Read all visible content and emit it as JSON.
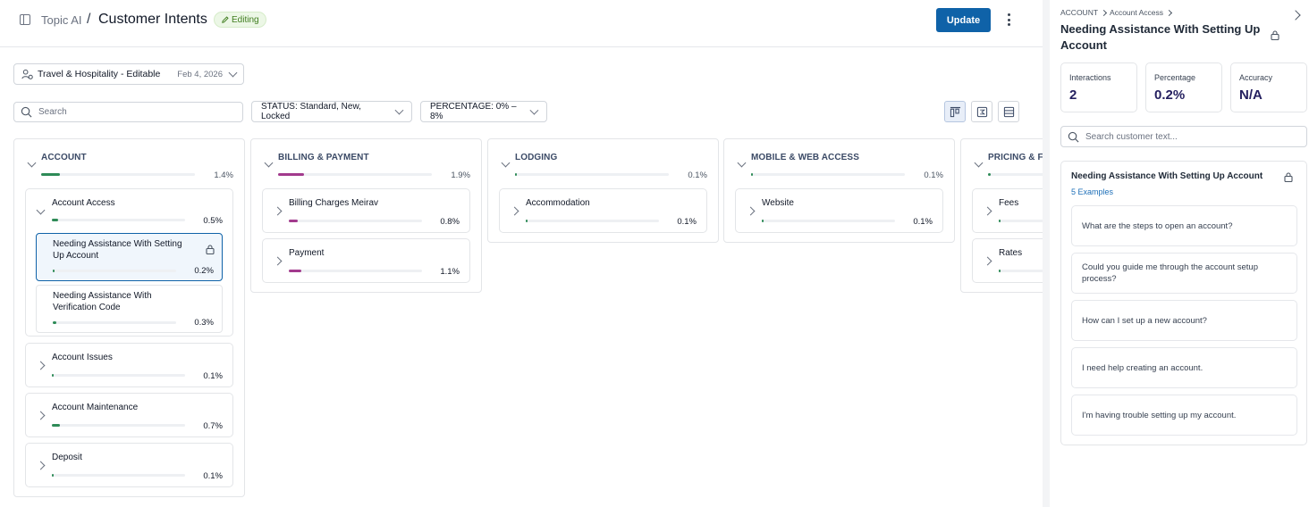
{
  "header": {
    "breadcrumb_root": "Topic AI",
    "separator": "/",
    "title": "Customer Intents",
    "badge": "Editing",
    "update_label": "Update"
  },
  "toolbar": {
    "model_name": "Travel & Hospitality - Editable",
    "model_date": "Feb 4, 2026",
    "search_placeholder": "Search",
    "status_filter": "STATUS:  Standard, New, Locked",
    "percentage_filter": "PERCENTAGE: 0% – 8%"
  },
  "colors": {
    "primary": "#0f62a8",
    "bar_green": "#2e8b57",
    "bar_purple": "#a23a8d",
    "stat_value": "#241f5f"
  },
  "columns": [
    {
      "title": "ACCOUNT",
      "pct_label": "1.4%",
      "pct": 1.4,
      "color": "#2e8b57",
      "cards": [
        {
          "title": "Account Access",
          "pct_label": "0.5%",
          "pct": 0.5,
          "expanded": true,
          "subs": [
            {
              "title": "Needing Assistance With Setting Up Account",
              "pct_label": "0.2%",
              "pct": 0.2,
              "locked": true,
              "selected": true
            },
            {
              "title": "Needing Assistance With Verification Code",
              "pct_label": "0.3%",
              "pct": 0.3,
              "locked": false,
              "selected": false
            }
          ]
        },
        {
          "title": "Account Issues",
          "pct_label": "0.1%",
          "pct": 0.1
        },
        {
          "title": "Account Maintenance",
          "pct_label": "0.7%",
          "pct": 0.7
        },
        {
          "title": "Deposit",
          "pct_label": "0.1%",
          "pct": 0.1
        }
      ]
    },
    {
      "title": "BILLING & PAYMENT",
      "pct_label": "1.9%",
      "pct": 1.9,
      "color": "#a23a8d",
      "cards": [
        {
          "title": "Billing Charges Meirav",
          "pct_label": "0.8%",
          "pct": 0.8
        },
        {
          "title": "Payment",
          "pct_label": "1.1%",
          "pct": 1.1
        }
      ]
    },
    {
      "title": "LODGING",
      "pct_label": "0.1%",
      "pct": 0.1,
      "color": "#2e8b57",
      "cards": [
        {
          "title": "Accommodation",
          "pct_label": "0.1%",
          "pct": 0.1
        }
      ]
    },
    {
      "title": "MOBILE & WEB ACCESS",
      "pct_label": "0.1%",
      "pct": 0.1,
      "color": "#2e8b57",
      "cards": [
        {
          "title": "Website",
          "pct_label": "0.1%",
          "pct": 0.1
        }
      ]
    },
    {
      "title": "PRICING & FE",
      "pct_label": "",
      "pct": 0.2,
      "color": "#2e8b57",
      "cards": [
        {
          "title": "Fees",
          "pct_label": "",
          "pct": 0.1
        },
        {
          "title": "Rates",
          "pct_label": "",
          "pct": 0.1
        }
      ]
    }
  ],
  "panel": {
    "breadcrumb": [
      "ACCOUNT",
      "Account Access"
    ],
    "title": "Needing Assistance With Setting Up Account",
    "stats": [
      {
        "label": "Interactions",
        "value": "2"
      },
      {
        "label": "Percentage",
        "value": "0.2%"
      },
      {
        "label": "Accuracy",
        "value": "N/A"
      }
    ],
    "search_placeholder": "Search customer text...",
    "examples_title": "Needing Assistance With Setting Up Account",
    "examples_count": "5 Examples",
    "examples": [
      "What are the steps to open an account?",
      "Could you guide me through the account setup process?",
      "How can I set up a new account?",
      "I need help creating an account.",
      "I'm having trouble setting up my account."
    ]
  }
}
